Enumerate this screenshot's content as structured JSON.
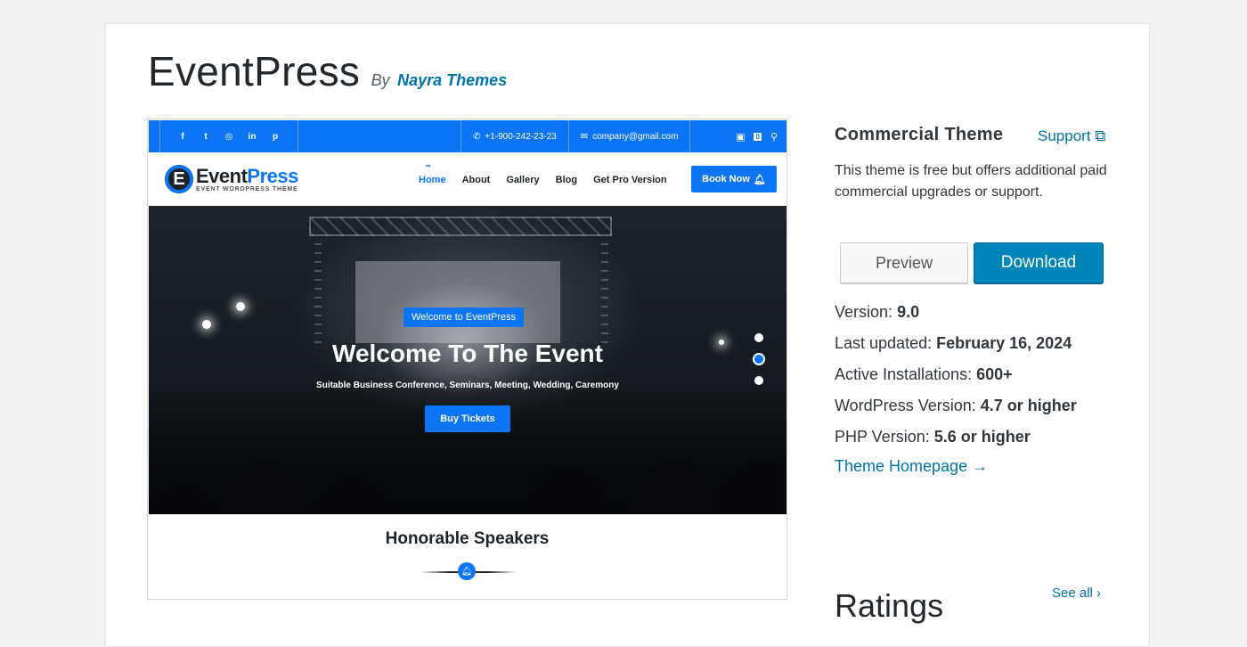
{
  "theme": {
    "name": "EventPress",
    "by_label": "By",
    "author": "Nayra Themes"
  },
  "screenshot": {
    "topbar": {
      "social_icons": [
        "facebook-icon",
        "twitter-icon",
        "instagram-icon",
        "linkedin-icon",
        "pinterest-icon"
      ],
      "social_glyphs": [
        "f",
        "t",
        "◎",
        "in",
        "p"
      ],
      "phone": "+1-900-242-23-23",
      "email": "company@gmail.com",
      "cart_count": "0"
    },
    "logo": {
      "mark": "E",
      "word_part1": "Event",
      "word_part2": "Press",
      "tagline": "EVENT WORDPRESS THEME"
    },
    "nav": [
      "Home",
      "About",
      "Gallery",
      "Blog",
      "Get Pro Version"
    ],
    "book_now": "Book Now",
    "hero": {
      "badge": "Welcome to EventPress",
      "title": "Welcome To The Event",
      "subtitle": "Suitable Business Conference, Seminars, Meeting, Wedding, Caremony",
      "button": "Buy Tickets",
      "active_slide": 2,
      "slide_count": 3
    },
    "speakers_heading": "Honorable Speakers"
  },
  "sidebar": {
    "commercial_title": "Commercial Theme",
    "support_label": "Support",
    "commercial_desc": "This theme is free but offers additional paid commercial upgrades or support.",
    "preview_label": "Preview",
    "download_label": "Download",
    "meta": [
      {
        "label": "Version:",
        "value": "9.0"
      },
      {
        "label": "Last updated:",
        "value": "February 16, 2024"
      },
      {
        "label": "Active Installations:",
        "value": "600+"
      },
      {
        "label": "WordPress Version:",
        "value": "4.7 or higher"
      },
      {
        "label": "PHP Version:",
        "value": "5.6 or higher"
      }
    ],
    "homepage_label": "Theme Homepage →",
    "ratings_title": "Ratings",
    "see_all_label": "See all"
  },
  "colors": {
    "wp_link": "#0073aa",
    "download_bg": "#0085ba",
    "theme_accent": "#0b75f5"
  }
}
